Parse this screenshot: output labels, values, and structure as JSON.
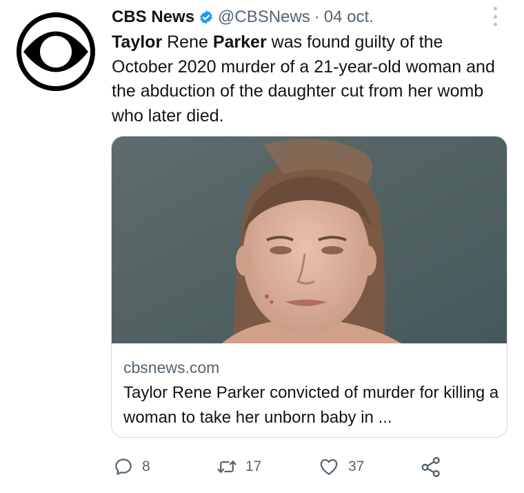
{
  "tweet": {
    "author_name": "CBS News",
    "handle": "@CBSNews",
    "separator": "·",
    "date": "04 oct.",
    "text": {
      "part1": "Taylor",
      "part2": " Rene ",
      "part3": "Parker",
      "part4": " was found guilty of the October 2020 murder of a 21-year-old woman and the abduction of the daughter cut from her womb who later died."
    },
    "avatar_icon": "cbs-eye-logo",
    "verified_icon": "verified-badge-icon"
  },
  "card": {
    "domain": "cbsnews.com",
    "title": "Taylor Rene Parker convicted of murder for killing a woman to take her unborn baby in ..."
  },
  "actions": {
    "reply_count": "8",
    "retweet_count": "17",
    "like_count": "37"
  },
  "colors": {
    "text_primary": "#0f1419",
    "text_secondary": "#536471",
    "verified_blue": "#1d9bf0",
    "card_border": "#cfd9de"
  }
}
